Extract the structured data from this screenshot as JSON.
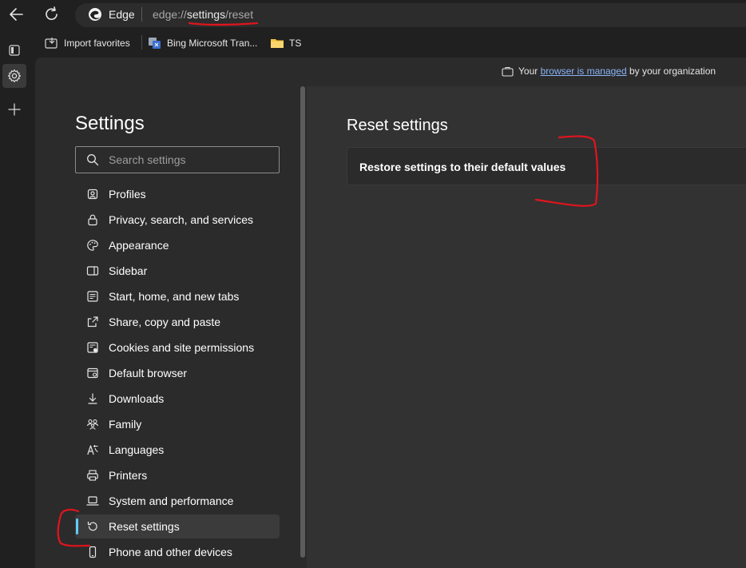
{
  "browser": {
    "name": "Edge",
    "url_prefix": "edge://",
    "url_host": "settings",
    "url_path": "/reset"
  },
  "favorites": [
    {
      "label": "Import favorites",
      "icon": "import-favorites-icon"
    },
    {
      "label": "Bing Microsoft Tran...",
      "icon": "bing-translator-icon"
    },
    {
      "label": "TS",
      "icon": "folder-icon"
    }
  ],
  "managed": {
    "prefix": "Your",
    "link": "browser is managed",
    "suffix": "by your organization"
  },
  "settings": {
    "title": "Settings",
    "search_placeholder": "Search settings",
    "nav": [
      {
        "label": "Profiles",
        "icon": "profiles-icon"
      },
      {
        "label": "Privacy, search, and services",
        "icon": "lock-icon"
      },
      {
        "label": "Appearance",
        "icon": "palette-icon"
      },
      {
        "label": "Sidebar",
        "icon": "sidebar-icon"
      },
      {
        "label": "Start, home, and new tabs",
        "icon": "home-tabs-icon"
      },
      {
        "label": "Share, copy and paste",
        "icon": "share-icon"
      },
      {
        "label": "Cookies and site permissions",
        "icon": "cookies-icon"
      },
      {
        "label": "Default browser",
        "icon": "default-browser-icon"
      },
      {
        "label": "Downloads",
        "icon": "download-icon"
      },
      {
        "label": "Family",
        "icon": "family-icon"
      },
      {
        "label": "Languages",
        "icon": "languages-icon"
      },
      {
        "label": "Printers",
        "icon": "printer-icon"
      },
      {
        "label": "System and performance",
        "icon": "laptop-icon"
      },
      {
        "label": "Reset settings",
        "icon": "reset-icon",
        "active": true
      },
      {
        "label": "Phone and other devices",
        "icon": "phone-icon"
      }
    ]
  },
  "main": {
    "title": "Reset settings",
    "restore_label": "Restore settings to their default values"
  },
  "colors": {
    "accent": "#60cdff",
    "annotation": "#e0141e",
    "link": "#8ab4f8"
  }
}
